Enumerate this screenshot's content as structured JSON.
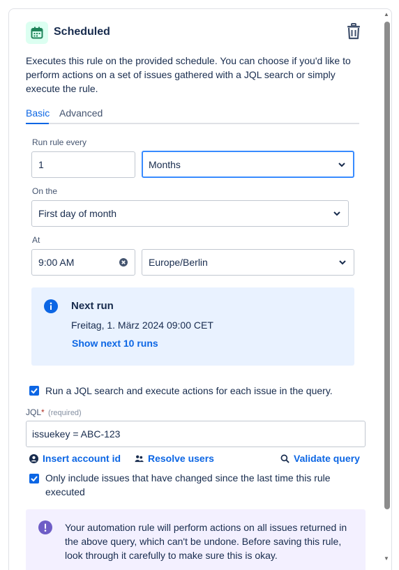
{
  "trigger": {
    "title": "Scheduled",
    "description": "Executes this rule on the provided schedule. You can choose if you'd like to perform actions on a set of issues gathered with a JQL search or simply execute the rule.",
    "icon": "calendar-icon",
    "icon_color": "#1f845a"
  },
  "tabs": [
    {
      "label": "Basic",
      "active": true
    },
    {
      "label": "Advanced",
      "active": false
    }
  ],
  "schedule": {
    "run_every_label": "Run rule every",
    "interval_value": "1",
    "interval_unit": "Months",
    "on_the_label": "On the",
    "on_the_value": "First day of month",
    "at_label": "At",
    "time_value": "9:00 AM",
    "timezone": "Europe/Berlin"
  },
  "next_run": {
    "title": "Next run",
    "date": "Freitag, 1. März 2024 09:00 CET",
    "link": "Show next 10 runs"
  },
  "jql": {
    "run_jql_label": "Run a JQL search and execute actions for each issue in the query.",
    "run_jql_checked": true,
    "label": "JQL",
    "required_marker": "*",
    "required_text": "(required)",
    "value": "issuekey = ABC-123",
    "insert_account": "Insert account id",
    "resolve_users": "Resolve users",
    "validate_query": "Validate query",
    "only_changed_label": "Only include issues that have changed since the last time this rule executed",
    "only_changed_checked": true
  },
  "warning": {
    "text": "Your automation rule will perform actions on all issues returned in the above query, which can't be undone. Before saving this rule, look through it carefully to make sure this is okay."
  },
  "colors": {
    "accent": "#0c66e4",
    "info_bg": "#e9f2ff",
    "warning_bg": "#f3f0ff",
    "discovery": "#6e5dc6"
  }
}
